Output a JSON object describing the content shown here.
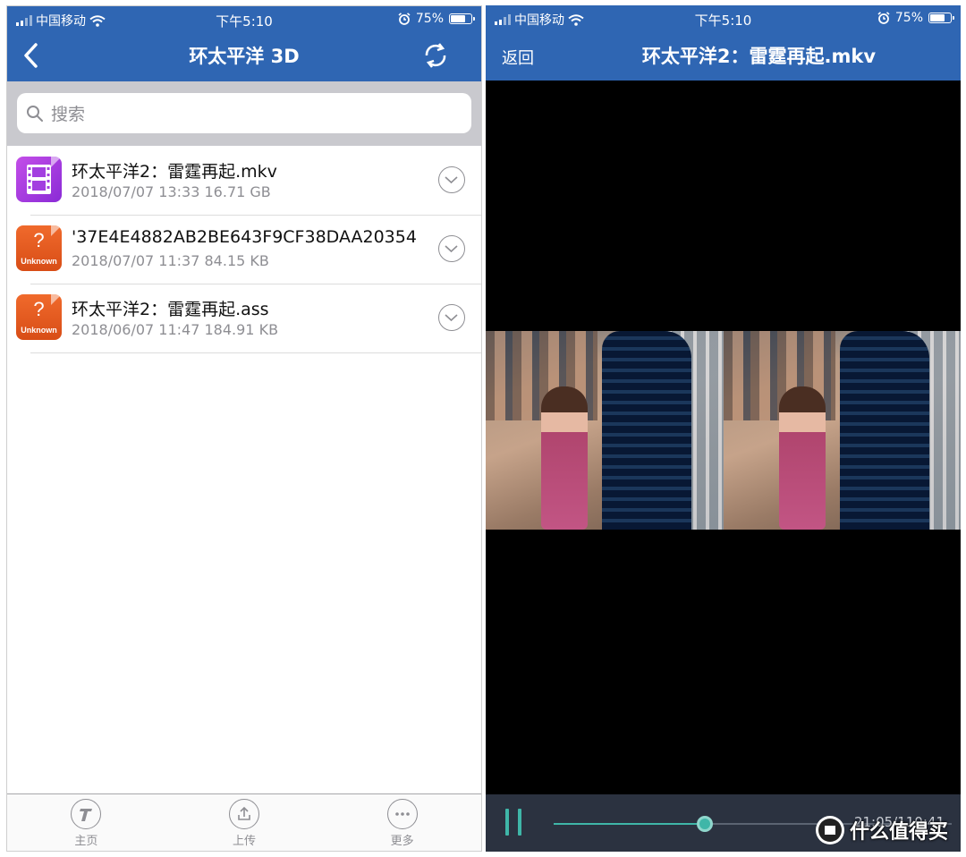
{
  "left": {
    "status": {
      "carrier": "中国移动",
      "time": "下午5:10",
      "battery": "75%",
      "battery_level": 0.75
    },
    "title": "环太平洋 3D",
    "search": {
      "placeholder": "搜索"
    },
    "files": [
      {
        "name": "环太平洋2：雷霆再起.mkv",
        "meta": "2018/07/07 13:33  16.71 GB",
        "icon": "video-file-icon"
      },
      {
        "name": "'37E4E4882AB2BE643F9CF38DAA20354",
        "meta": "2018/07/07 11:37  84.15 KB",
        "icon": "unknown-file-icon",
        "icon_q": "?",
        "icon_text": "Unknown"
      },
      {
        "name": "环太平洋2：雷霆再起.ass",
        "meta": "2018/06/07 11:47  184.91 KB",
        "icon": "unknown-file-icon",
        "icon_q": "?",
        "icon_text": "Unknown"
      }
    ],
    "tabs": [
      {
        "label": "主页",
        "icon": "home-t-icon"
      },
      {
        "label": "上传",
        "icon": "upload-icon"
      },
      {
        "label": "更多",
        "icon": "more-icon"
      }
    ]
  },
  "right": {
    "status": {
      "carrier": "中国移动",
      "time": "下午5:10",
      "battery": "75%",
      "battery_level": 0.75
    },
    "back_label": "返回",
    "title": "环太平洋2：雷霆再起.mkv",
    "player": {
      "time": "21:05/110:41",
      "progress": 0.38
    },
    "watermark": {
      "text": "什么值得买",
      "logo": "值"
    }
  },
  "colors": {
    "navbar": "#2f66b3",
    "accent": "#3fb6a8",
    "controls_bg": "#2b3240"
  }
}
